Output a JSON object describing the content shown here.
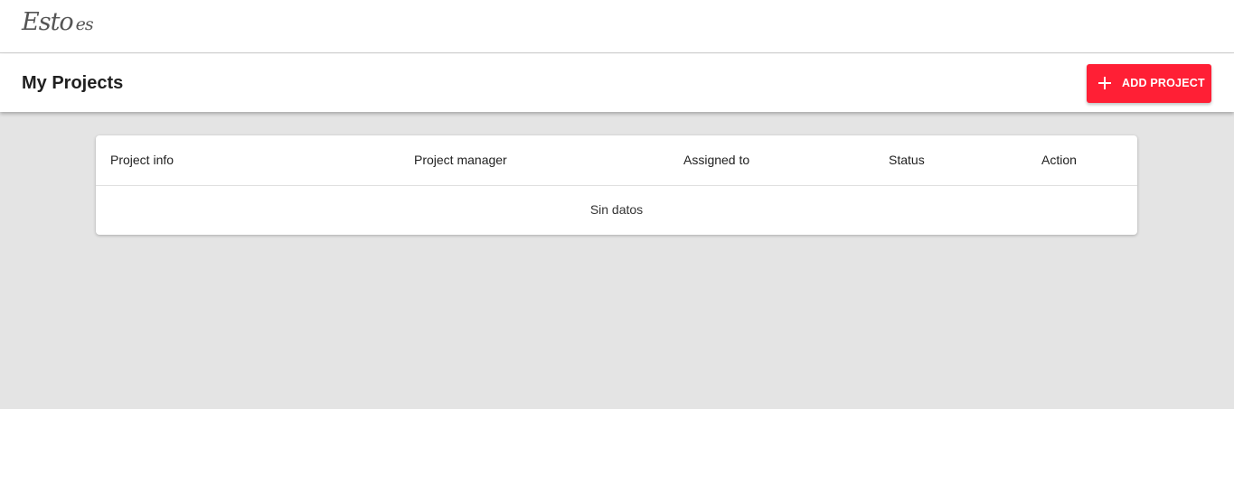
{
  "brand": {
    "logo_main": "Esto",
    "logo_small": "es"
  },
  "header": {
    "title": "My Projects",
    "add_button_label": "ADD PROJECT",
    "add_button_icon": "plus-icon"
  },
  "table": {
    "columns": [
      "Project info",
      "Project manager",
      "Assigned to",
      "Status",
      "Action"
    ],
    "empty_message": "Sin datos"
  },
  "colors": {
    "accent": "#ff1f35",
    "content_background": "#e4e4e4"
  }
}
